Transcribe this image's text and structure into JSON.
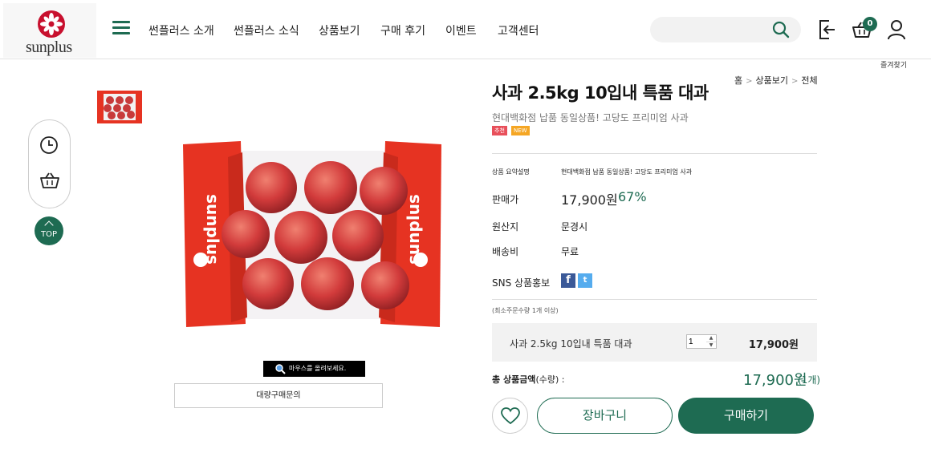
{
  "brand": {
    "name": "sunplus",
    "color": "#1e6b52",
    "logo_color": "#c8102e"
  },
  "nav": {
    "menu_icon": "hamburger-icon",
    "items": [
      "썬플러스 소개",
      "썬플러스 소식",
      "상품보기",
      "구매 후기",
      "이벤트",
      "고객센터"
    ]
  },
  "header": {
    "search_placeholder": "",
    "search_icon": "search-icon",
    "login_icon": "login-icon",
    "cart_icon": "basket-icon",
    "cart_count": "0",
    "user_icon": "user-icon",
    "favorites_label": "즐겨찾기"
  },
  "side": {
    "recent_icon": "clock-icon",
    "cart_icon": "basket-icon",
    "top_label": "TOP"
  },
  "breadcrumb": [
    "홈",
    "상품보기",
    "전체"
  ],
  "product": {
    "title": "사과 2.5kg 10입내 특품 대과",
    "subtitle": "현대백화점 납품 동일상품! 고당도 프리미엄 사과",
    "badges": [
      "추천",
      "NEW"
    ],
    "summary_label": "상품 요약설명",
    "summary_value": "현대백화점 납품 동일상품! 고당도 프리미엄 사과",
    "price_label": "판매가",
    "price": "17,900원",
    "discount": "67%",
    "origin_label": "원산지",
    "origin": "문경시",
    "shipping_label": "배송비",
    "shipping": "무료",
    "sns_label": "SNS 상품홍보",
    "sns": {
      "facebook": "f",
      "twitter": "t"
    },
    "min_order": "(최소주문수량 1개 이상)",
    "image_brand": "sunplus"
  },
  "option": {
    "name": "사과 2.5kg 10입내 특품 대과",
    "quantity": "1",
    "price": "17,900원"
  },
  "total": {
    "label": "총 상품금액",
    "qty_label": "(수량) :",
    "price": "17,900원",
    "count": "(1개)"
  },
  "actions": {
    "wishlist_icon": "heart-icon",
    "cart": "장바구니",
    "buy": "구매하기"
  },
  "gallery": {
    "zoom_hint": "마우스를 올려보세요.",
    "bulk_inquiry": "대량구매문의"
  }
}
